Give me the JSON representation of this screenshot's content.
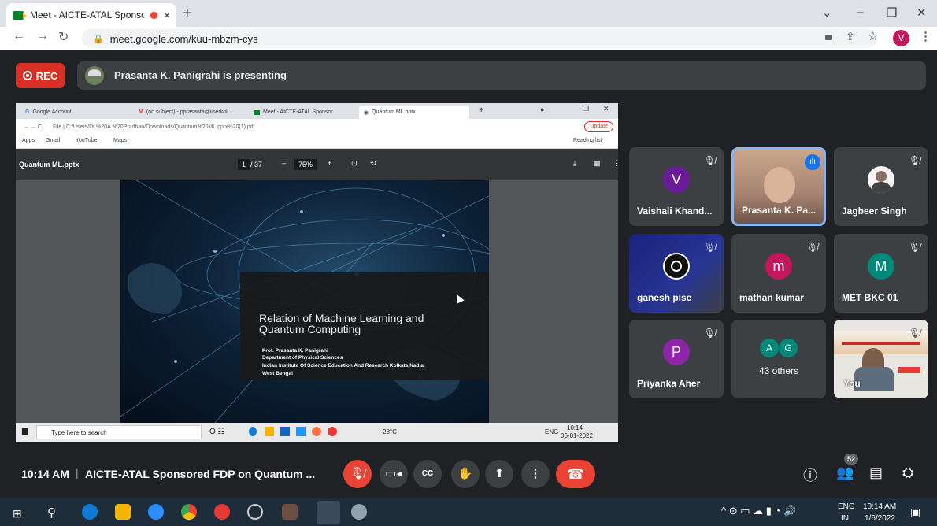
{
  "browser": {
    "tab_title": "Meet - AICTE-ATAL Sponsore",
    "tab_close": "×",
    "new_tab": "+",
    "url": "meet.google.com/kuu-mbzm-cys",
    "profile_initial": "V",
    "window_controls": [
      "⌄",
      "–",
      "❐",
      "✕"
    ]
  },
  "meet_top": {
    "rec_label": "REC",
    "presenting_text": "Prasanta K. Panigrahi is presenting"
  },
  "shared_screen": {
    "tabs": [
      "Google Account",
      "(no subject) - pprasanta@iiserkol...",
      "Meet - AICTE-ATAL Sponsor",
      "Quantum ML.pptx"
    ],
    "url": "File  |  C:/Users/Dr.%20A.%20Pradhan/Downloads/Quantum%20ML.pptx%20(1).pdf",
    "update_label": "Update",
    "bookmarks": [
      "Apps",
      "Gmail",
      "YouTube",
      "Maps"
    ],
    "reading_list": "Reading list",
    "pdf_title": "Quantum ML.pptx",
    "page_current": "1",
    "page_total": "/ 37",
    "zoom": "75%",
    "slide": {
      "title": "Relation of Machine Learning and Quantum Computing",
      "author": "Prof. Prasanta K. Panigrahi",
      "department": "Department of Physical Sciences",
      "institute": "Indian Institute Of Science Education And Research Kolkata Nadia,",
      "location": "West Bengal"
    },
    "taskbar_search": "Type here to search",
    "weather": "28°C",
    "lang": "ENG",
    "time": "10:14",
    "date": "06-01-2022"
  },
  "participants": [
    {
      "name": "Vaishali Khand...",
      "initial": "V",
      "color": "#6a1b9a"
    },
    {
      "name": "Prasanta K. Pa...",
      "initial": "",
      "color": "#8d6e63"
    },
    {
      "name": "Jagbeer Singh",
      "initial": "",
      "color": "#5f6368"
    },
    {
      "name": "ganesh pise",
      "initial": "",
      "color": "#1a237e"
    },
    {
      "name": "mathan kumar",
      "initial": "m",
      "color": "#c2185b"
    },
    {
      "name": "MET BKC 01",
      "initial": "M",
      "color": "#00897b"
    },
    {
      "name": "Priyanka Aher",
      "initial": "P",
      "color": "#8e24aa"
    },
    {
      "name": "43 others",
      "initial": "",
      "color": "#00897b"
    },
    {
      "name": "You",
      "initial": "",
      "color": "#bdbdbd"
    }
  ],
  "others_initials": [
    "A",
    "G"
  ],
  "meeting": {
    "time": "10:14 AM",
    "separator": "|",
    "title": "AICTE-ATAL Sponsored FDP on Quantum ...",
    "participant_count": "52"
  },
  "win_taskbar": {
    "lang_top": "ENG",
    "lang_bottom": "IN",
    "time": "10:14 AM",
    "date": "1/6/2022"
  }
}
